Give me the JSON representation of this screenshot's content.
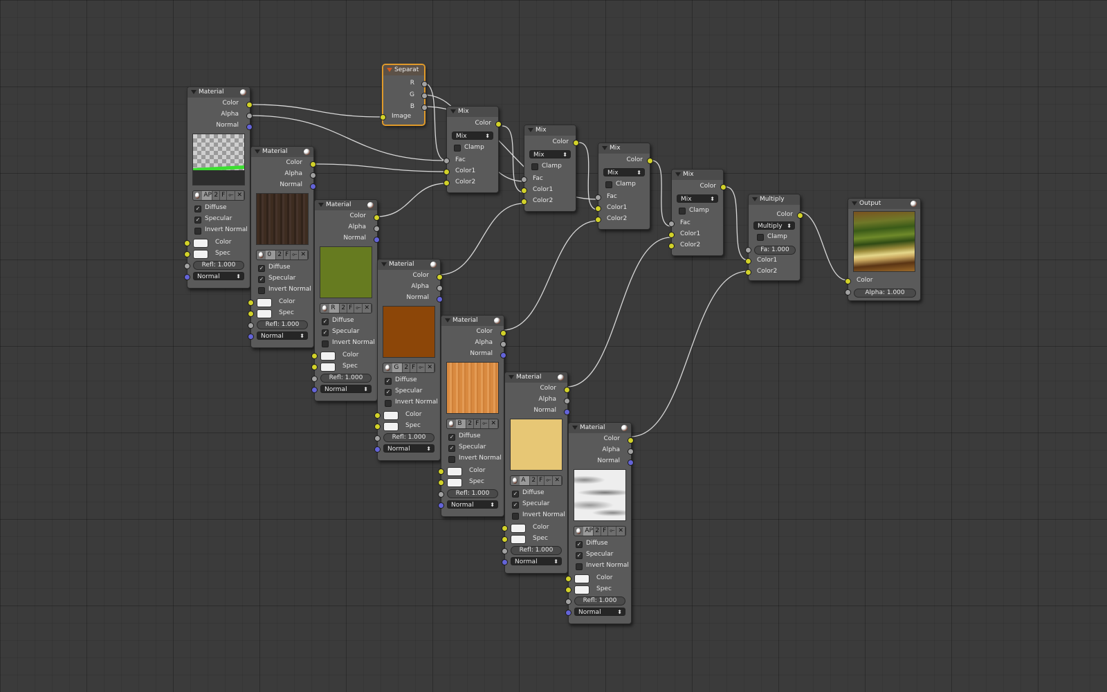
{
  "editor": {
    "type": "node-editor"
  },
  "icons": {
    "collapse": "triangle-down-icon",
    "material": "material-sphere-icon",
    "checkbox": "check-icon",
    "remove": "x-icon"
  },
  "colors": {
    "socket_color": "#d2d22a",
    "socket_value": "#a2a2a2",
    "socket_vector": "#6464d8",
    "selected_border": "#e09a2a"
  },
  "separate": {
    "title": "Separat",
    "outputs": [
      "R",
      "G",
      "B"
    ],
    "input": "Image"
  },
  "materials": [
    {
      "title": "Material",
      "outputs": [
        "Color",
        "Alpha",
        "Normal"
      ],
      "texture_name": "AP",
      "tex_items": [
        "2",
        "F",
        "⟜"
      ],
      "checks": [
        "Diffuse",
        "Specular",
        "Invert Normal"
      ],
      "checked": [
        true,
        true,
        false
      ],
      "inputs": [
        "Color",
        "Spec"
      ],
      "refl": "Refl: 1.000",
      "normal": "Normal"
    },
    {
      "title": "Material",
      "outputs": [
        "Color",
        "Alpha",
        "Normal"
      ],
      "texture_name": "0",
      "tex_items": [
        "2",
        "F",
        "⟜"
      ],
      "checks": [
        "Diffuse",
        "Specular",
        "Invert Normal"
      ],
      "checked": [
        true,
        true,
        false
      ],
      "inputs": [
        "Color",
        "Spec"
      ],
      "refl": "Refl: 1.000",
      "normal": "Normal"
    },
    {
      "title": "Material",
      "outputs": [
        "Color",
        "Alpha",
        "Normal"
      ],
      "texture_name": "R",
      "tex_items": [
        "2",
        "F",
        "⟜"
      ],
      "checks": [
        "Diffuse",
        "Specular",
        "Invert Normal"
      ],
      "checked": [
        true,
        true,
        false
      ],
      "inputs": [
        "Color",
        "Spec"
      ],
      "refl": "Refl: 1.000",
      "normal": "Normal"
    },
    {
      "title": "Material",
      "outputs": [
        "Color",
        "Alpha",
        "Normal"
      ],
      "texture_name": "G",
      "tex_items": [
        "2",
        "F",
        "⟜"
      ],
      "checks": [
        "Diffuse",
        "Specular",
        "Invert Normal"
      ],
      "checked": [
        true,
        true,
        false
      ],
      "inputs": [
        "Color",
        "Spec"
      ],
      "refl": "Refl: 1.000",
      "normal": "Normal"
    },
    {
      "title": "Material",
      "outputs": [
        "Color",
        "Alpha",
        "Normal"
      ],
      "texture_name": "B",
      "tex_items": [
        "2",
        "F",
        "⟜"
      ],
      "checks": [
        "Diffuse",
        "Specular",
        "Invert Normal"
      ],
      "checked": [
        true,
        true,
        false
      ],
      "inputs": [
        "Color",
        "Spec"
      ],
      "refl": "Refl: 1.000",
      "normal": "Normal"
    },
    {
      "title": "Material",
      "outputs": [
        "Color",
        "Alpha",
        "Normal"
      ],
      "texture_name": "A",
      "tex_items": [
        "2",
        "F",
        "⟜"
      ],
      "checks": [
        "Diffuse",
        "Specular",
        "Invert Normal"
      ],
      "checked": [
        true,
        true,
        false
      ],
      "inputs": [
        "Color",
        "Spec"
      ],
      "refl": "Refl: 1.000",
      "normal": "Normal"
    },
    {
      "title": "Material",
      "outputs": [
        "Color",
        "Alpha",
        "Normal"
      ],
      "texture_name": "AP",
      "tex_items": [
        "2",
        "F",
        "⟜"
      ],
      "checks": [
        "Diffuse",
        "Specular",
        "Invert Normal"
      ],
      "checked": [
        true,
        true,
        false
      ],
      "inputs": [
        "Color",
        "Spec"
      ],
      "refl": "Refl: 1.000",
      "normal": "Normal"
    }
  ],
  "mixes": [
    {
      "title": "Mix",
      "output": "Color",
      "blend": "Mix",
      "clamp": "Clamp",
      "inputs": [
        "Fac",
        "Color1",
        "Color2"
      ]
    },
    {
      "title": "Mix",
      "output": "Color",
      "blend": "Mix",
      "clamp": "Clamp",
      "inputs": [
        "Fac",
        "Color1",
        "Color2"
      ]
    },
    {
      "title": "Mix",
      "output": "Color",
      "blend": "Mix",
      "clamp": "Clamp",
      "inputs": [
        "Fac",
        "Color1",
        "Color2"
      ]
    },
    {
      "title": "Mix",
      "output": "Color",
      "blend": "Mix",
      "clamp": "Clamp",
      "inputs": [
        "Fac",
        "Color1",
        "Color2"
      ]
    }
  ],
  "multiply": {
    "title": "Multiply",
    "output": "Color",
    "blend": "Multiply",
    "clamp": "Clamp",
    "fac": "Fa: 1.000",
    "inputs": [
      "Color1",
      "Color2"
    ]
  },
  "output": {
    "title": "Output",
    "input": "Color",
    "alpha": "Alpha: 1.000"
  }
}
